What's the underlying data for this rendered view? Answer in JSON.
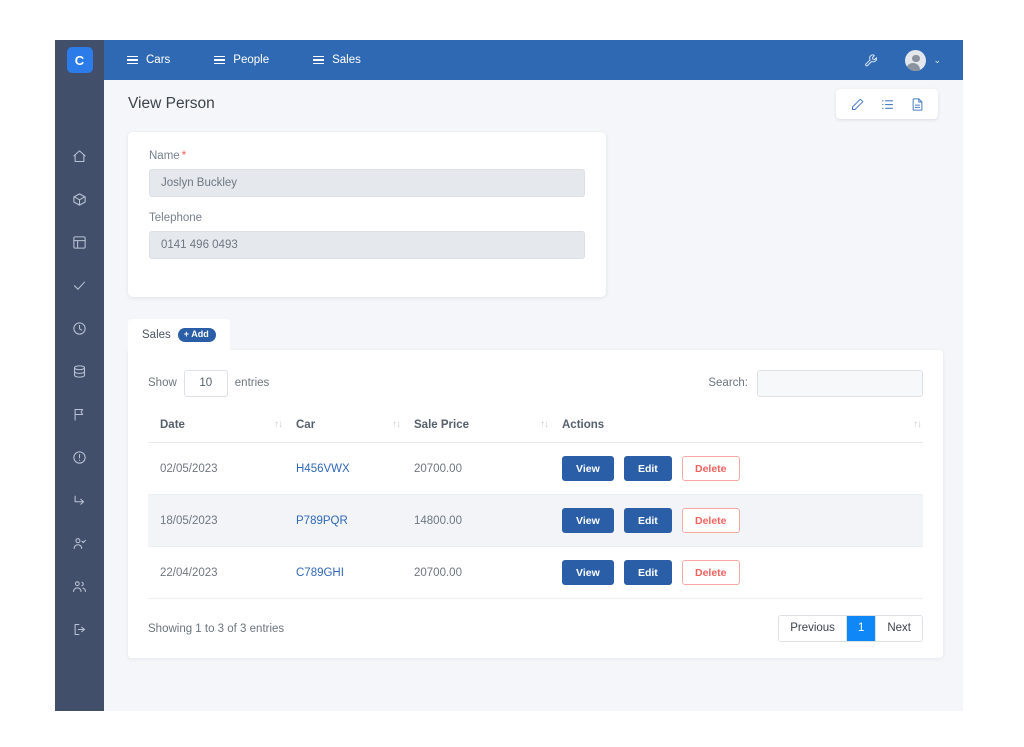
{
  "app": {
    "logo_letter": "C",
    "brand_color": "#2b7ce9",
    "sidebar_color": "#414f6b",
    "navbar_color": "#3069b3"
  },
  "navbar": {
    "links": [
      {
        "label": "Cars",
        "icon": "hamburger-icon"
      },
      {
        "label": "People",
        "icon": "hamburger-icon"
      },
      {
        "label": "Sales",
        "icon": "hamburger-icon"
      }
    ],
    "tools_icon": "wrench-icon",
    "avatar_icon": "user-avatar-icon",
    "chevron": "⌄"
  },
  "sidebar": {
    "items": [
      {
        "icon": "home-icon"
      },
      {
        "icon": "box-icon"
      },
      {
        "icon": "layout-icon"
      },
      {
        "icon": "check-icon"
      },
      {
        "icon": "clock-icon"
      },
      {
        "icon": "database-icon"
      },
      {
        "icon": "flag-icon"
      },
      {
        "icon": "alert-circle-icon"
      },
      {
        "icon": "arrow-turn-icon"
      },
      {
        "icon": "user-check-icon"
      },
      {
        "icon": "users-icon"
      },
      {
        "icon": "logout-icon"
      }
    ]
  },
  "page": {
    "title": "View Person",
    "actions": [
      {
        "name": "edit-icon",
        "glyph": "pencil"
      },
      {
        "name": "list-icon",
        "glyph": "list"
      },
      {
        "name": "document-icon",
        "glyph": "file"
      }
    ]
  },
  "form": {
    "fields": [
      {
        "label": "Name",
        "required": true,
        "required_mark": "*",
        "value": "Joslyn Buckley"
      },
      {
        "label": "Telephone",
        "required": false,
        "required_mark": "",
        "value": "0141 496 0493"
      }
    ]
  },
  "tabs": [
    {
      "label": "Sales",
      "badge": "+ Add",
      "active": true
    }
  ],
  "table": {
    "show_label": "Show",
    "entries_label": "entries",
    "page_length": "10",
    "search_label": "Search:",
    "search_value": "",
    "search_placeholder": "",
    "sort_glyph": "↑↓",
    "columns": [
      "Date",
      "Car",
      "Sale Price",
      "Actions"
    ],
    "rows": [
      {
        "date": "02/05/2023",
        "car": "H456VWX",
        "price": "20700.00",
        "buttons": [
          "View",
          "Edit",
          "Delete"
        ]
      },
      {
        "date": "18/05/2023",
        "car": "P789PQR",
        "price": "14800.00",
        "buttons": [
          "View",
          "Edit",
          "Delete"
        ]
      },
      {
        "date": "22/04/2023",
        "car": "C789GHI",
        "price": "20700.00",
        "buttons": [
          "View",
          "Edit",
          "Delete"
        ]
      }
    ],
    "info": "Showing 1 to 3 of 3 entries",
    "pagination": {
      "previous": "Previous",
      "pages": [
        "1"
      ],
      "next": "Next",
      "active_page": "1"
    }
  }
}
